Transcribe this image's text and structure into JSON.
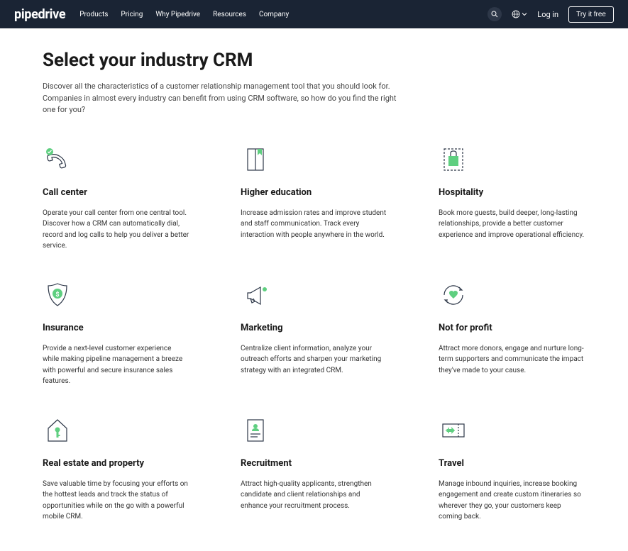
{
  "header": {
    "logo": "pipedrive",
    "nav": [
      "Products",
      "Pricing",
      "Why Pipedrive",
      "Resources",
      "Company"
    ],
    "login": "Log in",
    "try": "Try it free"
  },
  "page": {
    "title": "Select your industry CRM",
    "subtitle": "Discover all the characteristics of a customer relationship management tool that you should look for. Companies in almost every industry can benefit from using CRM software, so how do you find the right one for you?"
  },
  "cards": [
    {
      "title": "Call center",
      "desc": "Operate your call center from one central tool. Discover how a CRM can automatically dial, record and log calls to help you deliver a better service."
    },
    {
      "title": "Higher education",
      "desc": "Increase admission rates and improve student and staff communication. Track every interaction with people anywhere in the world."
    },
    {
      "title": "Hospitality",
      "desc": "Book more guests, build deeper, long-lasting relationships, provide a better customer experience and improve operational efficiency."
    },
    {
      "title": "Insurance",
      "desc": "Provide a next-level customer experience while making pipeline management a breeze with powerful and secure insurance sales features."
    },
    {
      "title": "Marketing",
      "desc": "Centralize client information, analyze your outreach efforts and sharpen your marketing strategy with an integrated CRM."
    },
    {
      "title": "Not for profit",
      "desc": "Attract more donors, engage and nurture long-term supporters and communicate the impact they've made to your cause."
    },
    {
      "title": "Real estate and property",
      "desc": "Save valuable time by focusing your efforts on the hottest leads and track the status of opportunities while on the go with a powerful mobile CRM."
    },
    {
      "title": "Recruitment",
      "desc": "Attract high-quality applicants, strengthen candidate and client relationships and enhance your recruitment process."
    },
    {
      "title": "Travel",
      "desc": "Manage inbound inquiries, increase booking engagement and create custom itineraries so wherever they go, your customers keep coming back."
    }
  ]
}
